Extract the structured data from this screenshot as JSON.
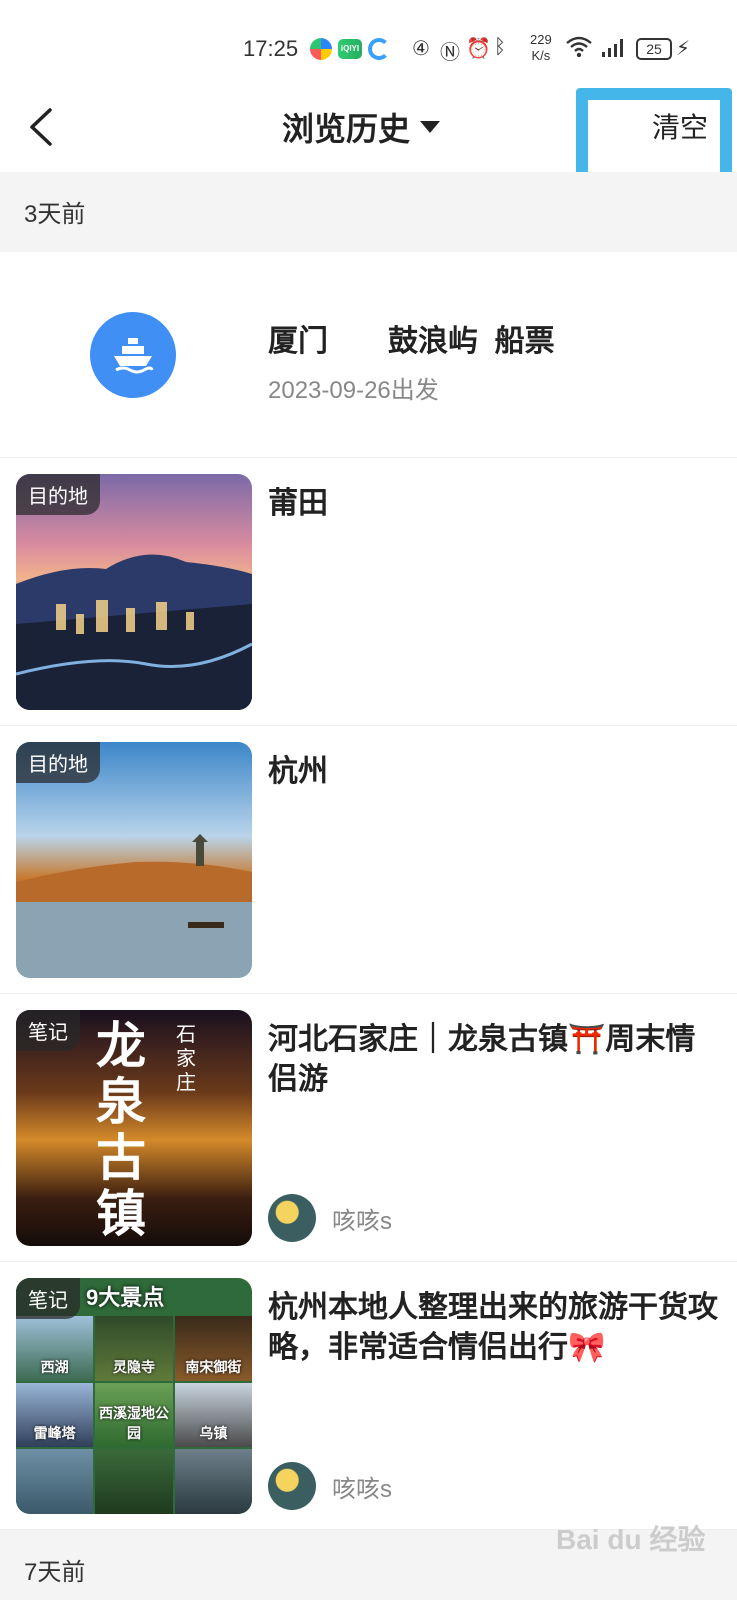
{
  "status_bar": {
    "time": "17:25",
    "rate_value": "229",
    "rate_unit": "K/s",
    "battery": "25",
    "icons": [
      "app-icon",
      "iqiyi-icon",
      "app-icon",
      "4g-icon",
      "nfc-icon",
      "alarm-icon",
      "bluetooth-icon",
      "wifi-icon",
      "5g-signal-icon",
      "battery-icon",
      "charging-icon"
    ]
  },
  "nav": {
    "title": "浏览历史",
    "clear_label": "清空"
  },
  "sections": [
    {
      "label": "3天前"
    },
    {
      "label": "7天前"
    }
  ],
  "ferry": {
    "title": "厦门　　鼓浪屿  船票",
    "date": "2023-09-26出发"
  },
  "items": [
    {
      "tag": "目的地",
      "title": "莆田",
      "author": ""
    },
    {
      "tag": "目的地",
      "title": "杭州",
      "author": ""
    },
    {
      "tag": "笔记",
      "title": "河北石家庄｜龙泉古镇⛩️周末情侣游",
      "author": "咳咳s",
      "art_text_large": "龙泉古镇",
      "art_text_small": "石家庄"
    },
    {
      "tag": "笔记",
      "title": "杭州本地人整理出来的旅游干货攻略，非常适合情侣出行🎀",
      "author": "咳咳s",
      "art_banner": "9大景点",
      "art_cells": [
        "西湖",
        "灵隐寺",
        "南宋御街",
        "雷峰塔",
        "西溪湿地公园",
        "乌镇",
        "",
        "",
        ""
      ]
    }
  ],
  "watermark": "Bai du 经验"
}
